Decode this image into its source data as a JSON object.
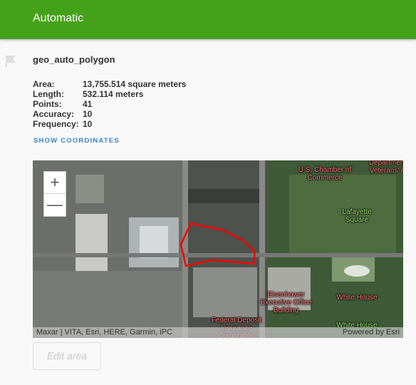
{
  "header": {
    "title": "Automatic"
  },
  "item": {
    "name": "geo_auto_polygon",
    "properties": [
      {
        "label": "Area:",
        "value": "13,755.514 square meters"
      },
      {
        "label": "Length:",
        "value": "532.114 meters"
      },
      {
        "label": "Points:",
        "value": "41"
      },
      {
        "label": "Accuracy:",
        "value": "10"
      },
      {
        "label": "Frequency:",
        "value": "10"
      }
    ],
    "show_coordinates": "SHOW COORDINATES"
  },
  "map": {
    "zoom_in": "+",
    "zoom_out": "—",
    "labels": {
      "chamber": "U.S. Chamber of Commerce",
      "veterans": "Department Veterans' A",
      "lafayette": "Lafayette Square",
      "eisenhower": "Eisenhower Executive Office Building",
      "whitehouse1": "White House",
      "whitehouse2": "White House",
      "fdic": "Federal Deposit Insurance Corporation"
    },
    "attribution": "Maxar | VITA, Esri, HERE, Garmin, iPC",
    "powered": "Powered by Esri",
    "polygon_color": "#ff0000"
  },
  "actions": {
    "edit_area": "Edit area"
  }
}
